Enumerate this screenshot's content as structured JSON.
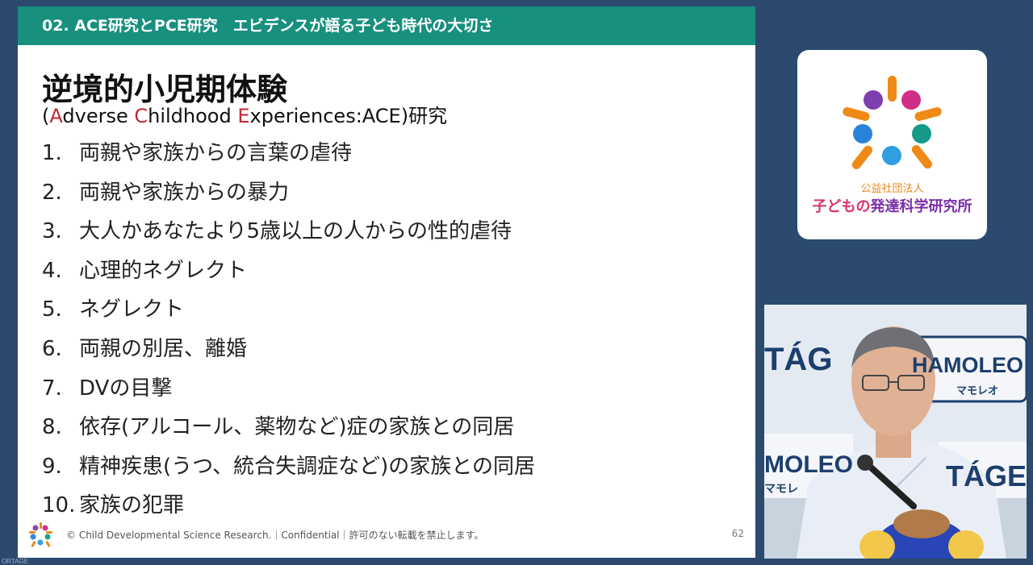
{
  "slide": {
    "header": "02. ACE研究とPCE研究　エビデンスが語る子ども時代の大切さ",
    "title": "逆境的小児期体験",
    "subtitle": {
      "open": "(",
      "a_letter": "A",
      "a_rest": "dverse ",
      "c_letter": "C",
      "c_rest": "hildhood ",
      "e_letter": "E",
      "e_rest": "xperiences:ACE",
      "close": ")研究"
    },
    "items": [
      {
        "num": "1.",
        "text": "両親や家族からの言葉の虐待"
      },
      {
        "num": "2.",
        "text": "両親や家族からの暴力"
      },
      {
        "num": "3.",
        "text": "大人かあなたより5歳以上の人からの性的虐待"
      },
      {
        "num": "4.",
        "text": "心理的ネグレクト"
      },
      {
        "num": "5.",
        "text": "ネグレクト"
      },
      {
        "num": "6.",
        "text": "両親の別居、離婚"
      },
      {
        "num": "7.",
        "text": "DVの目撃"
      },
      {
        "num": "8.",
        "text": "依存(アルコール、薬物など)症の家族との同居"
      },
      {
        "num": "9.",
        "text": "精神疾患(うつ、統合失調症など)の家族との同居"
      },
      {
        "num": "10.",
        "text": "家族の犯罪"
      }
    ],
    "footer": "© Child Developmental Science Research.｜Confidential｜許可のない転載を禁止します。",
    "page_number": "62"
  },
  "logo_card": {
    "org_type": "公益社団法人",
    "org_name_part1": "子どもの",
    "org_name_part2": "発達科学研究所"
  },
  "video": {
    "backdrop_texts": [
      "TÁG",
      "HAMOLEO",
      "マモレオ",
      "MOLEO",
      "マモレ",
      "TÁGE"
    ]
  },
  "bottom_label": "ORTAGE",
  "colors": {
    "header_bg": "#17907e",
    "page_bg": "#2b4a6e",
    "accent_red": "#c0282f"
  }
}
